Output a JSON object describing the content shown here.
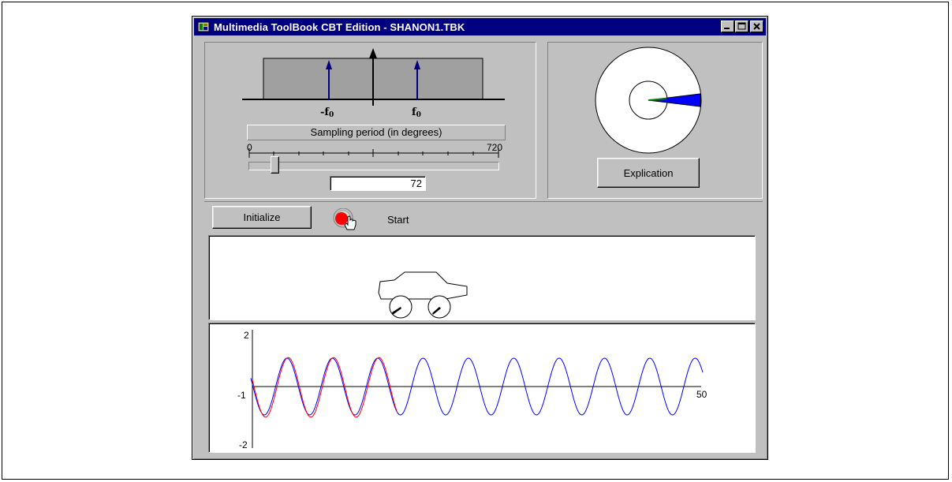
{
  "window": {
    "title": "Multimedia ToolBook CBT Edition - SHANON1.TBK",
    "controls": {
      "minimize": "_",
      "maximize": "□",
      "close": "×"
    }
  },
  "spectrum": {
    "neg_freq_label": "-f",
    "pos_freq_label": "f",
    "freq_subscript": "0"
  },
  "sampling": {
    "label": "Sampling period (in degrees)",
    "min": "0",
    "max": "720",
    "value": "72"
  },
  "dial": {
    "explication_label": "Explication"
  },
  "controls": {
    "initialize_label": "Initialize",
    "start_label": "Start"
  },
  "plot": {
    "y_max_label": "2",
    "y_min_label": "-2",
    "origin_label": "-1",
    "x_max_label": "50",
    "axis_color": "#000000",
    "sampled_color": "#0000ff",
    "reconstructed_color": "#ff0000"
  },
  "icons": [
    "toolbook-app-icon",
    "minimize-icon",
    "maximize-icon",
    "close-icon",
    "record-icon",
    "hand-pointer-icon",
    "car-icon"
  ]
}
